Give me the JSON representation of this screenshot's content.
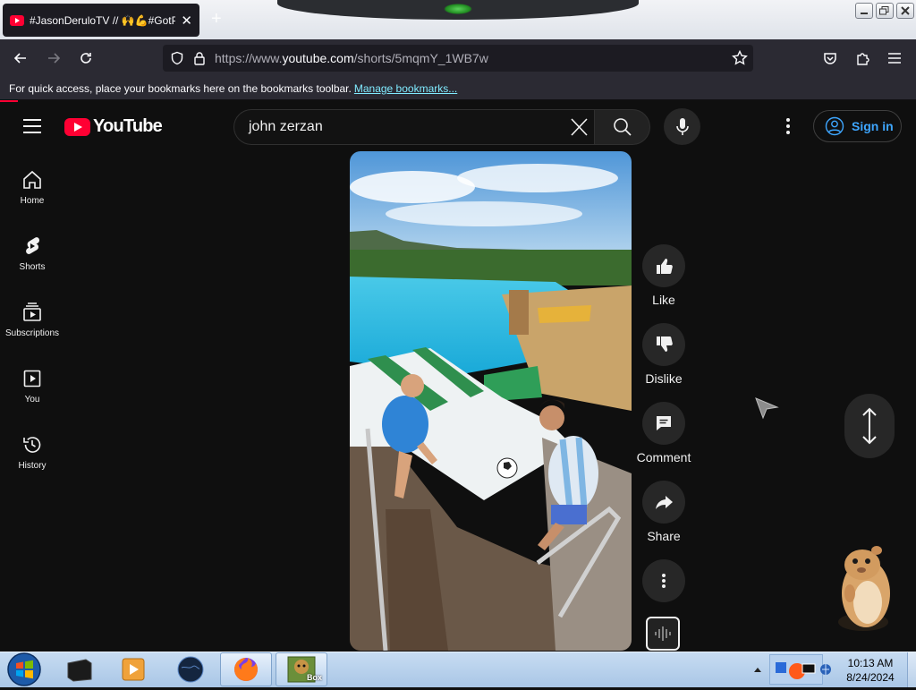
{
  "browser": {
    "tab_title": "#JasonDeruloTV // 🙌💪#GotPe",
    "tab_close": "✕",
    "new_tab": "+",
    "url_prefix": "https://www.",
    "url_domain": "youtube.com",
    "url_path": "/shorts/5mqmY_1WB7w",
    "bookmarks_message": "For quick access, place your bookmarks here on the bookmarks toolbar.",
    "bookmarks_link": "Manage bookmarks..."
  },
  "youtube": {
    "logo_text": "YouTube",
    "search_value": "john zerzan",
    "sign_in_label": "Sign in",
    "sidebar": [
      {
        "label": "Home",
        "icon": "home-icon"
      },
      {
        "label": "Shorts",
        "icon": "shorts-icon"
      },
      {
        "label": "Subscriptions",
        "icon": "subscriptions-icon"
      },
      {
        "label": "You",
        "icon": "you-icon"
      },
      {
        "label": "History",
        "icon": "history-icon"
      }
    ],
    "actions": {
      "like": "Like",
      "dislike": "Dislike",
      "comment": "Comment",
      "share": "Share"
    }
  },
  "taskbar": {
    "time": "10:13 AM",
    "date": "8/24/2024",
    "box_label": "Box"
  },
  "colors": {
    "youtube_red": "#ff0033",
    "link_blue": "#3ea6ff",
    "page_bg": "#0f0f0f",
    "button_bg": "#272727"
  }
}
